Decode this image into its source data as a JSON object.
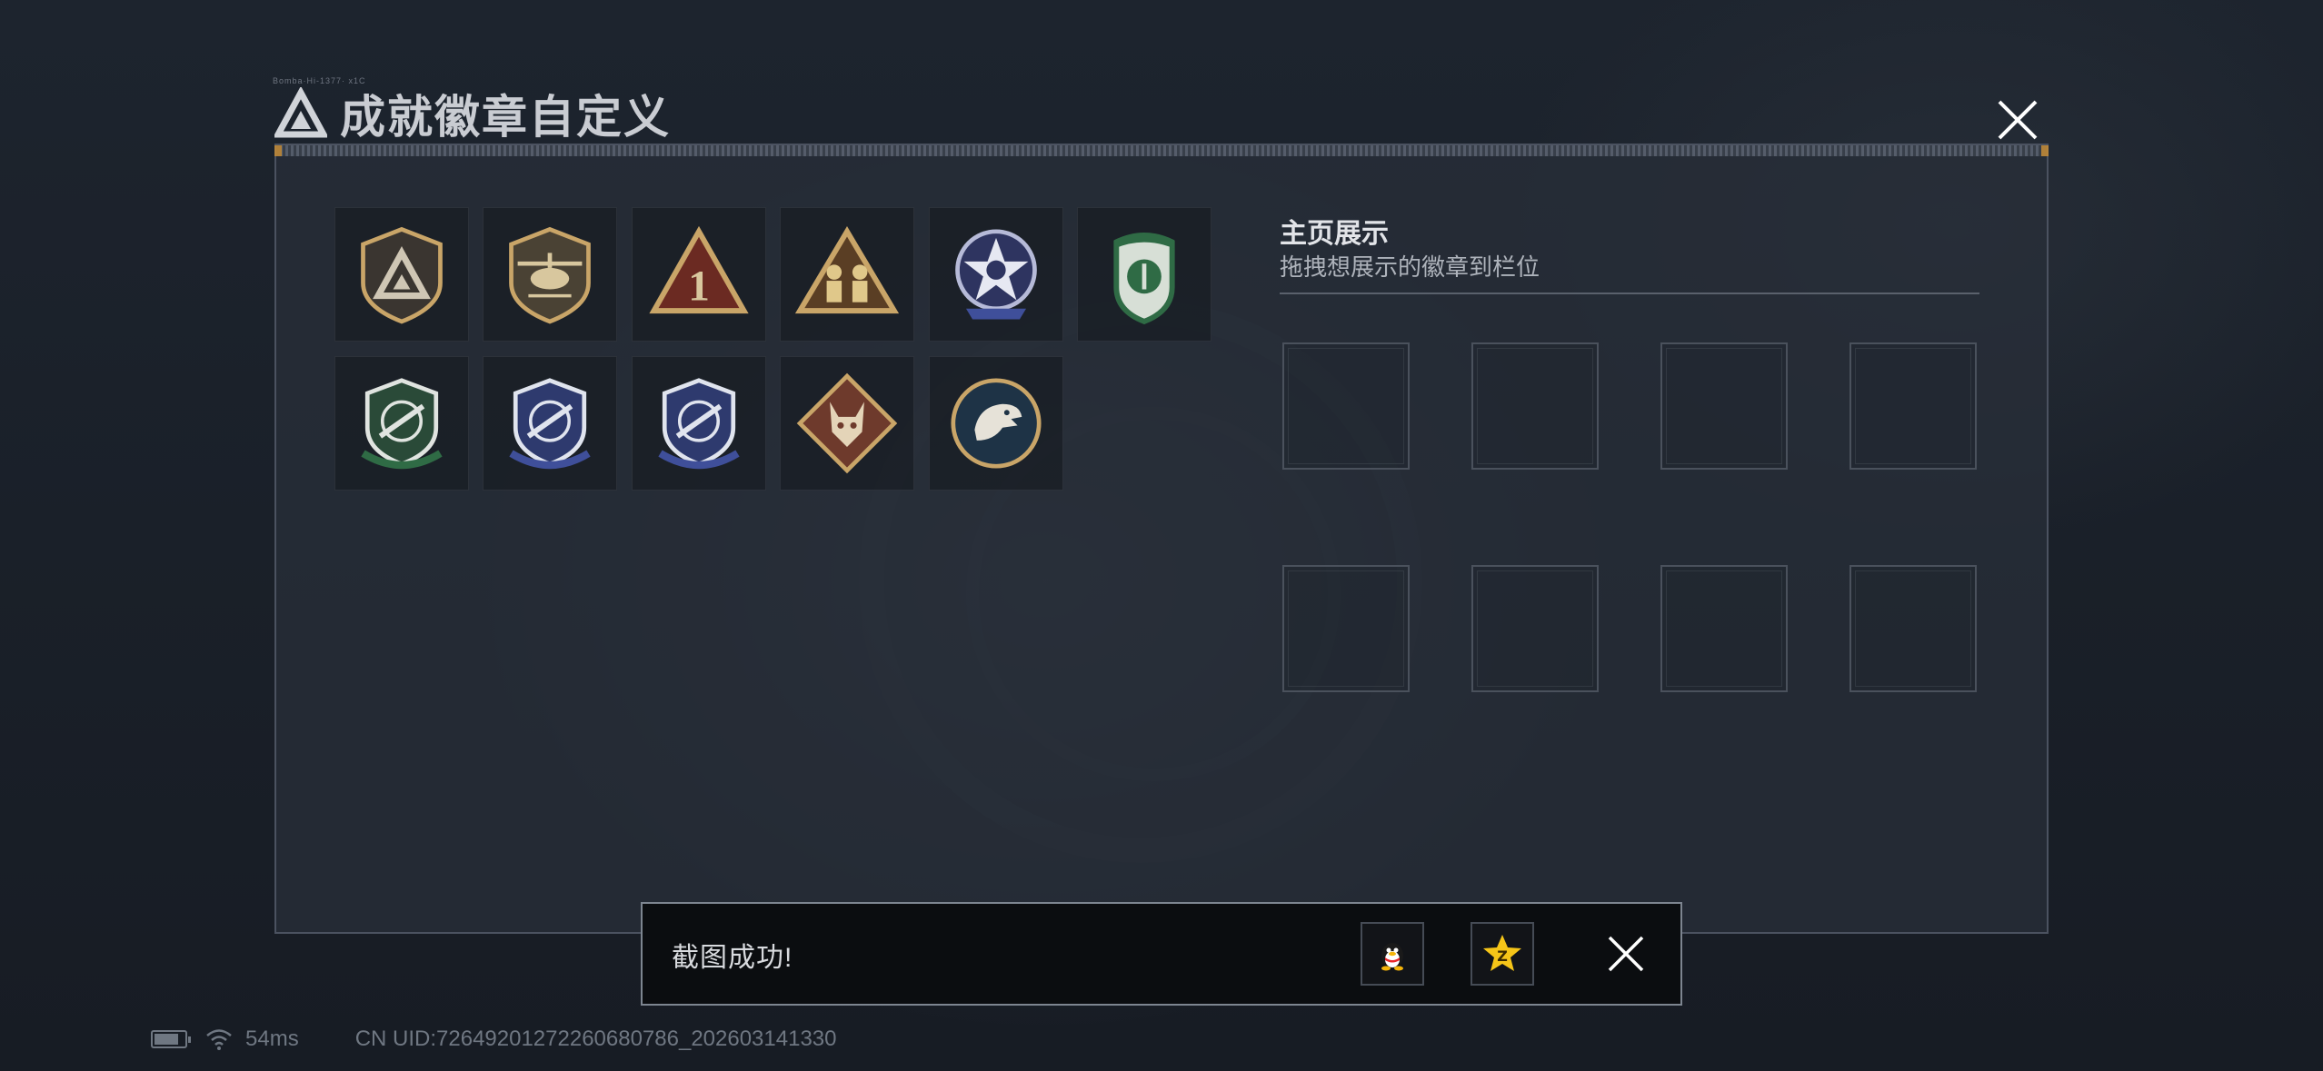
{
  "header": {
    "title": "成就徽章自定义",
    "tiny_text": "Bomba·Hi-1377· x1C",
    "logo_icon": "triangle-logo-icon",
    "close_icon": "close-icon"
  },
  "showcase": {
    "title": "主页展示",
    "subtitle": "拖拽想展示的徽章到栏位",
    "slot_count": 8
  },
  "badges": [
    {
      "name": "triangle-shield-badge",
      "color": "#c9a568"
    },
    {
      "name": "helicopter-badge",
      "color": "#c9a568"
    },
    {
      "name": "rank-one-badge",
      "color": "#c9a568"
    },
    {
      "name": "soldiers-badge",
      "color": "#c9a568"
    },
    {
      "name": "star-skull-badge",
      "color": "#8f96c8"
    },
    {
      "name": "green-shield-badge",
      "color": "#2f6b45"
    },
    {
      "name": "green-rifle-badge",
      "color": "#2f6b45"
    },
    {
      "name": "blue-rifle-badge-1",
      "color": "#3f4f9a"
    },
    {
      "name": "blue-rifle-badge-2",
      "color": "#3f4f9a"
    },
    {
      "name": "wolf-badge",
      "color": "#8a4a38"
    },
    {
      "name": "eagle-badge",
      "color": "#2a4358"
    }
  ],
  "toast": {
    "message": "截图成功!",
    "share_qq_icon": "qq-penguin-icon",
    "share_qzone_icon": "qzone-star-icon",
    "close_icon": "close-icon"
  },
  "status_bar": {
    "ping": "54ms",
    "uid": "CN UID:7264920127226068078​6_202603141330"
  }
}
